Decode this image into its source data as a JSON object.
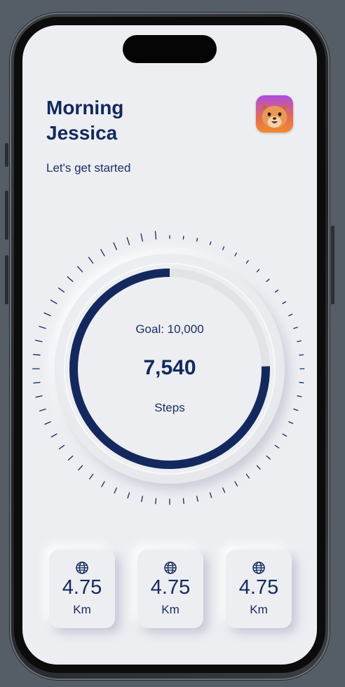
{
  "header": {
    "greeting_line1": "Morning",
    "greeting_line2": "Jessica",
    "subtitle": "Let's get started"
  },
  "avatar": {
    "icon": "hamster-face-icon"
  },
  "steps": {
    "goal_text": "Goal: 10,000",
    "value": "7,540",
    "label": "Steps",
    "progress": 0.754
  },
  "stats": [
    {
      "icon": "globe-icon",
      "value": "4.75",
      "unit": "Km"
    },
    {
      "icon": "globe-icon",
      "value": "4.75",
      "unit": "Km"
    },
    {
      "icon": "globe-icon",
      "value": "4.75",
      "unit": "Km"
    }
  ],
  "colors": {
    "accent": "#13295e",
    "background": "#edeef2",
    "track": "#e2e3e6",
    "avatar_top": "#b04be0",
    "avatar_bottom": "#f28a2a"
  }
}
